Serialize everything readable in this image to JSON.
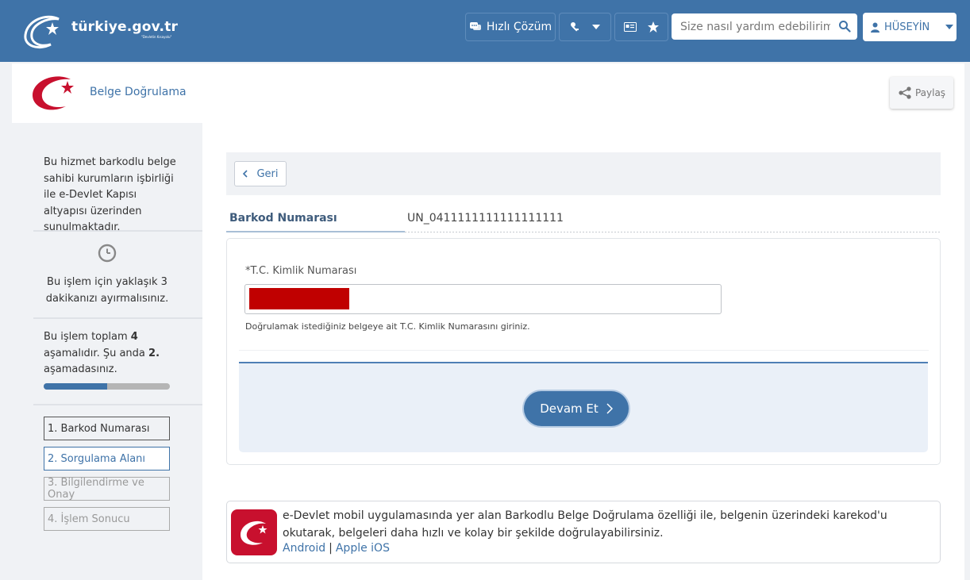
{
  "header": {
    "logo_text": "türkiye.gov.tr",
    "logo_tagline": "\"Devletin Kısayolu\"",
    "quick_solution_label": "Hızlı Çözüm",
    "search_placeholder": "Size nasıl yardım edebilirim?",
    "user_name": "HÜSEYİN",
    "colors": {
      "brand": "#3f73a8",
      "accent_red": "#c8102e"
    }
  },
  "page": {
    "title": "Belge Doğrulama",
    "share_label": "Paylaş"
  },
  "sidebar": {
    "intro": "Bu hizmet barkodlu belge sahibi kurumların işbirliği ile e-Devlet Kapısı altyapısı üzerinden sunulmaktadır.",
    "time_note": "Bu işlem için yaklaşık 3 dakikanızı ayırmalısınız.",
    "stage_prefix": "Bu işlem toplam ",
    "stage_total": "4",
    "stage_mid": " aşamalıdır. Şu anda ",
    "stage_current": "2.",
    "stage_suffix": " aşamadasınız.",
    "progress_fraction": 0.5,
    "steps": [
      {
        "label": "1. Barkod Numarası",
        "state": "completed"
      },
      {
        "label": "2. Sorgulama Alanı",
        "state": "active"
      },
      {
        "label": "3. Bilgilendirme ve Onay",
        "state": "disabled"
      },
      {
        "label": "4. İşlem Sonucu",
        "state": "disabled"
      }
    ]
  },
  "main": {
    "back_label": "Geri",
    "barcode_label": "Barkod Numarası",
    "barcode_value": "UN_0411111111111111111",
    "tc_label": "*T.C. Kimlik Numarası",
    "tc_help": "Doğrulamak istediğiniz belgeye ait T.C. Kimlik Numarasını giriniz.",
    "continue_label": "Devam Et",
    "mobile_info": "e-Devlet mobil uygulamasında yer alan Barkodlu Belge Doğrulama özelliği ile, belgenin üzerindeki karekod'u okutarak, belgeleri daha hızlı ve kolay bir şekilde doğrulayabilirsiniz.",
    "android_label": "Android",
    "link_separator": "|",
    "ios_label": "Apple iOS"
  }
}
